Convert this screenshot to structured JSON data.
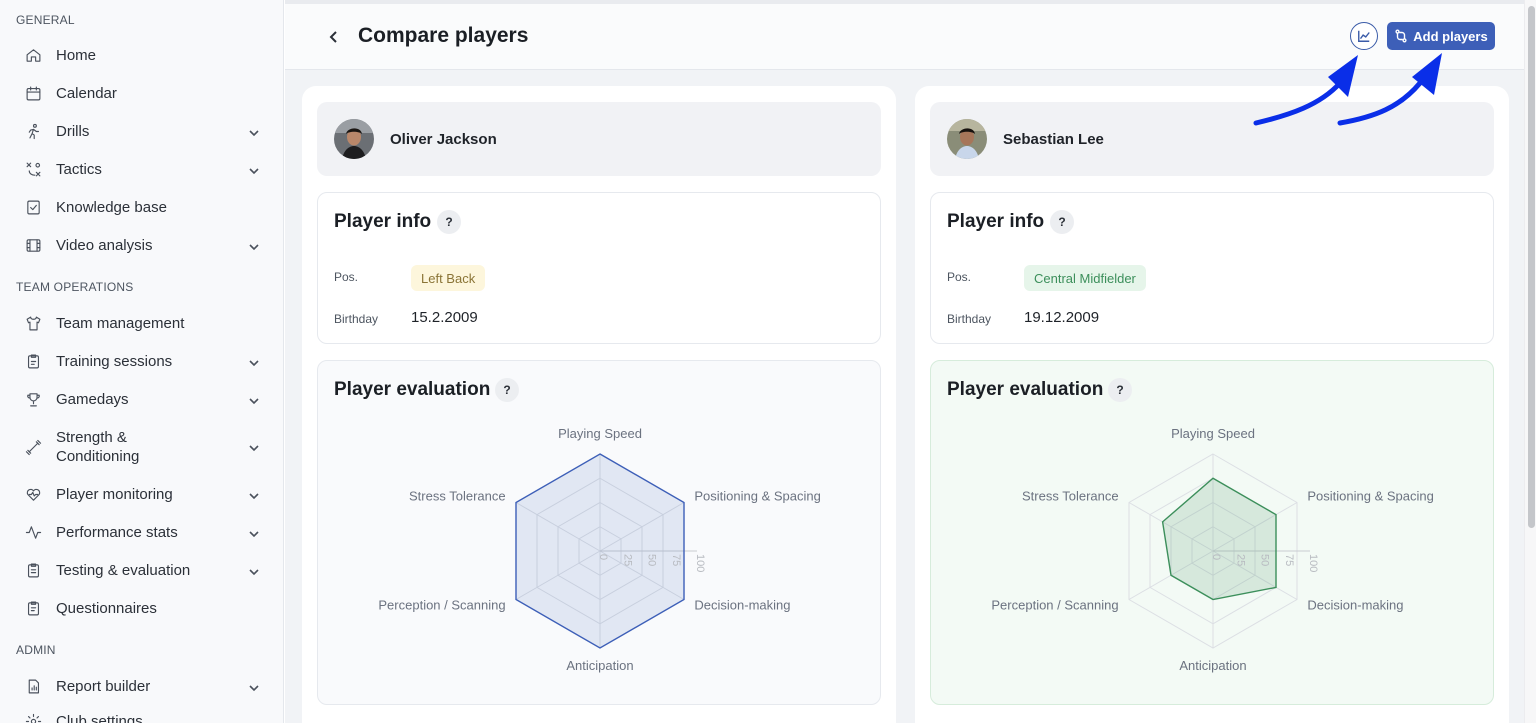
{
  "sidebar": {
    "sections": [
      {
        "label": "GENERAL"
      },
      {
        "label": "TEAM OPERATIONS"
      },
      {
        "label": "ADMIN"
      }
    ],
    "items": [
      {
        "label": "Home",
        "icon": "home-icon"
      },
      {
        "label": "Calendar",
        "icon": "calendar-icon"
      },
      {
        "label": "Drills",
        "icon": "running-icon"
      },
      {
        "label": "Tactics",
        "icon": "tactics-icon"
      },
      {
        "label": "Knowledge base",
        "icon": "checklist-icon"
      },
      {
        "label": "Video analysis",
        "icon": "film-icon"
      },
      {
        "label": "Team management",
        "icon": "shirt-icon"
      },
      {
        "label": "Training sessions",
        "icon": "clipboard-icon"
      },
      {
        "label": "Gamedays",
        "icon": "trophy-icon"
      },
      {
        "label": "Strength &",
        "label2": "Conditioning",
        "icon": "dumbbell-icon"
      },
      {
        "label": "Player monitoring",
        "icon": "heart-pulse-icon"
      },
      {
        "label": "Performance stats",
        "icon": "activity-icon"
      },
      {
        "label": "Testing & evaluation",
        "icon": "test-clipboard-icon"
      },
      {
        "label": "Questionnaires",
        "icon": "questionnaire-icon"
      },
      {
        "label": "Report builder",
        "icon": "report-icon"
      },
      {
        "label": "Club settings",
        "icon": "settings-icon"
      }
    ]
  },
  "header": {
    "title": "Compare players",
    "add_players_label": "Add players",
    "chart_icon": "chart-line-icon"
  },
  "players": [
    {
      "name": "Oliver Jackson",
      "info_title": "Player info",
      "pos_label": "Pos.",
      "position": "Left Back",
      "birthday_label": "Birthday",
      "birthday": "15.2.2009",
      "eval_title": "Player evaluation",
      "help": "?",
      "color": "#3d5fb8"
    },
    {
      "name": "Sebastian Lee",
      "info_title": "Player info",
      "pos_label": "Pos.",
      "position": "Central Midfielder",
      "birthday_label": "Birthday",
      "birthday": "19.12.2009",
      "eval_title": "Player evaluation",
      "help": "?",
      "color": "#3c8f5b"
    }
  ],
  "chart_data": [
    {
      "type": "radar",
      "series": [
        {
          "name": "Oliver Jackson",
          "values": [
            100,
            100,
            100,
            100,
            100,
            100
          ]
        }
      ],
      "categories": [
        "Playing Speed",
        "Positioning & Spacing",
        "Decision-making",
        "Anticipation",
        "Perception / Scanning",
        "Stress Tolerance"
      ],
      "ticks": [
        "0",
        "25",
        "50",
        "75",
        "100"
      ],
      "range": [
        0,
        100
      ]
    },
    {
      "type": "radar",
      "series": [
        {
          "name": "Sebastian Lee",
          "values": [
            75,
            75,
            75,
            50,
            50,
            60
          ]
        }
      ],
      "categories": [
        "Playing Speed",
        "Positioning & Spacing",
        "Decision-making",
        "Anticipation",
        "Perception / Scanning",
        "Stress Tolerance"
      ],
      "ticks": [
        "0",
        "25",
        "50",
        "75",
        "100"
      ],
      "range": [
        0,
        100
      ]
    }
  ]
}
